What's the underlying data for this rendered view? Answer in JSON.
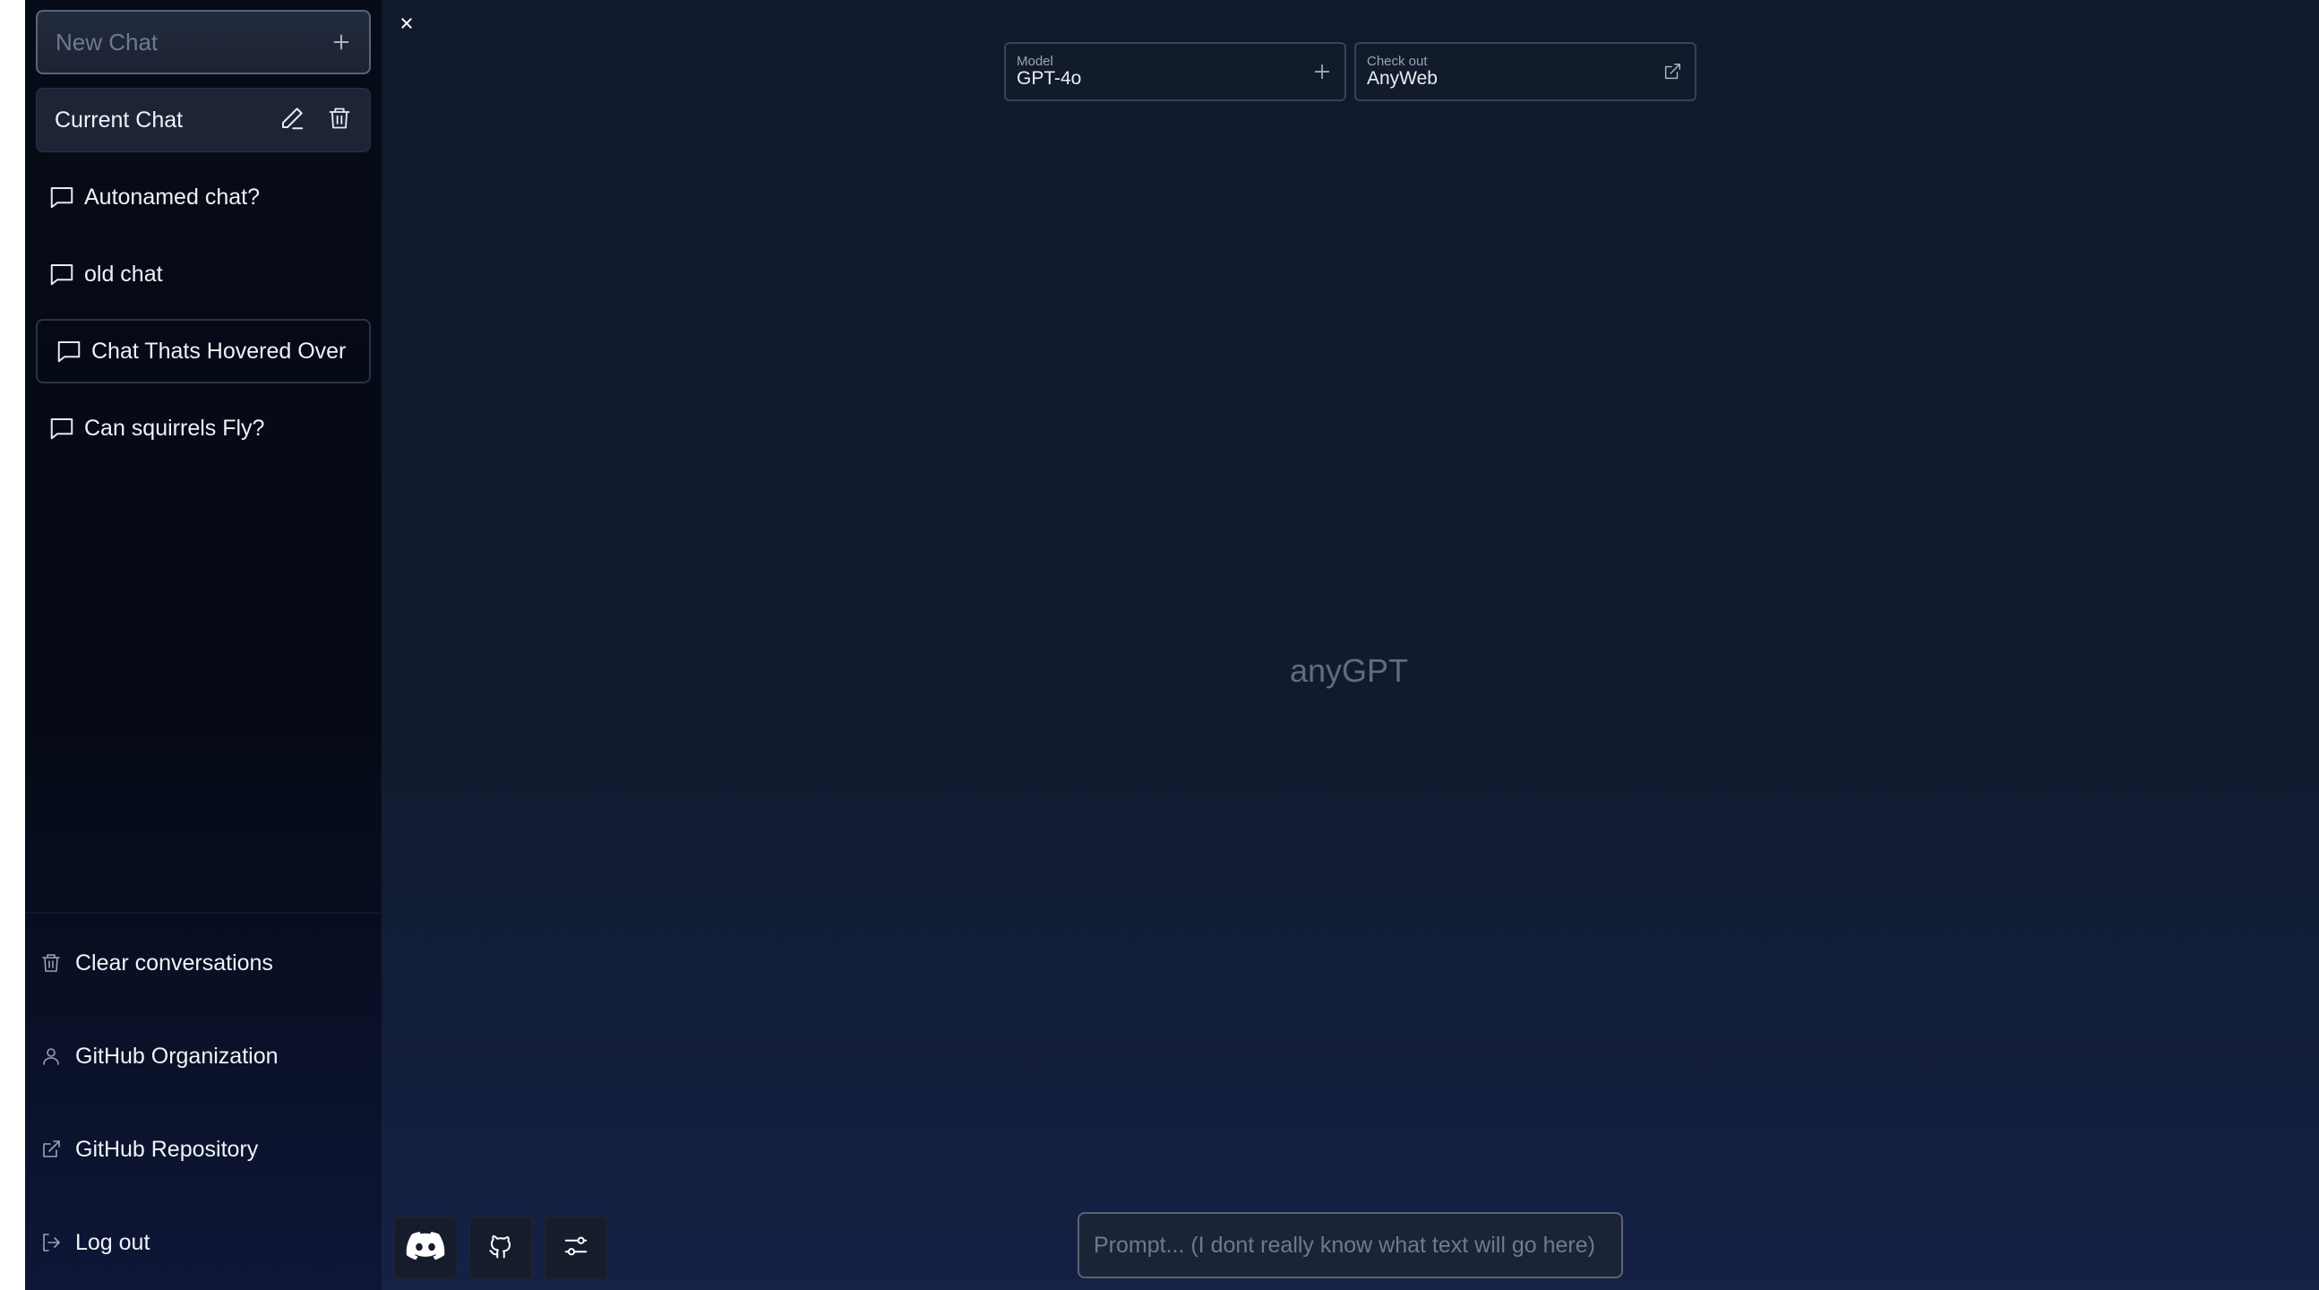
{
  "sidebar": {
    "new_chat_label": "New Chat",
    "current_chat_label": "Current Chat",
    "chats": [
      {
        "label": "Autonamed chat?"
      },
      {
        "label": "old chat"
      },
      {
        "label": "Chat Thats Hovered Over"
      },
      {
        "label": "Can squirrels Fly?"
      }
    ],
    "bottom_items": [
      {
        "label": "Clear conversations",
        "icon": "trash-icon"
      },
      {
        "label": "GitHub Organization",
        "icon": "user-icon"
      },
      {
        "label": "GitHub Repository",
        "icon": "external-link-icon"
      },
      {
        "label": "Log out",
        "icon": "logout-icon"
      }
    ]
  },
  "header": {
    "model_caption": "Model",
    "model_value": "GPT-4o",
    "checkout_caption": "Check out",
    "checkout_value": "AnyWeb"
  },
  "main": {
    "logo_text": "anyGPT",
    "prompt_placeholder": "Prompt... (I dont really know what text will go here)"
  },
  "footer_buttons": [
    "discord-icon",
    "github-icon",
    "settings-sliders-icon"
  ],
  "colors": {
    "background": "#111a2c",
    "sidebar": "#060b17",
    "accent_text": "#eef1f6",
    "muted_text": "#6f7a92"
  }
}
